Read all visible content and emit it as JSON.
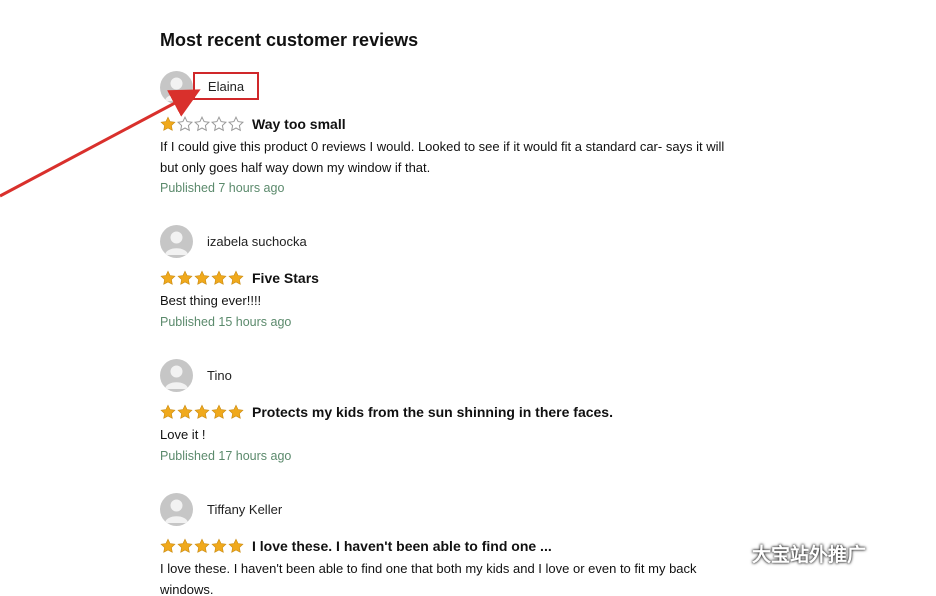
{
  "page": {
    "heading": "Most recent customer reviews"
  },
  "reviews": [
    {
      "reviewer": "Elaina",
      "rating": 1,
      "title": "Way too small",
      "body_lines": [
        "If I could give this product 0 reviews I would. Looked to see if it would fit a standard car- says it will",
        "but only goes half way down my window if that."
      ],
      "published": "Published 7 hours ago",
      "highlighted": true
    },
    {
      "reviewer": "izabela suchocka",
      "rating": 5,
      "title": "Five Stars",
      "body_lines": [
        "Best thing ever!!!!"
      ],
      "published": "Published 15 hours ago",
      "highlighted": false
    },
    {
      "reviewer": "Tino",
      "rating": 5,
      "title": "Protects my kids from the sun shinning in there faces.",
      "body_lines": [
        "Love it !"
      ],
      "published": "Published 17 hours ago",
      "highlighted": false
    },
    {
      "reviewer": "Tiffany Keller",
      "rating": 5,
      "title": "I love these. I haven't been able to find one ...",
      "body_lines": [
        "I love these. I haven't been able to find one that both my kids and I love or even to fit my back",
        "windows."
      ],
      "published": "",
      "highlighted": false
    }
  ],
  "annotation": {
    "arrow_color": "#d9302c",
    "box_color": "#d0282a"
  },
  "watermark": {
    "text": "大宝站外推广",
    "icon": "wechat-icon"
  },
  "colors": {
    "star_filled": "#f0a91c",
    "star_empty_stroke": "#9a9a9a",
    "published_text": "#5b8a6c",
    "avatar_bg": "#c6c6c6"
  }
}
